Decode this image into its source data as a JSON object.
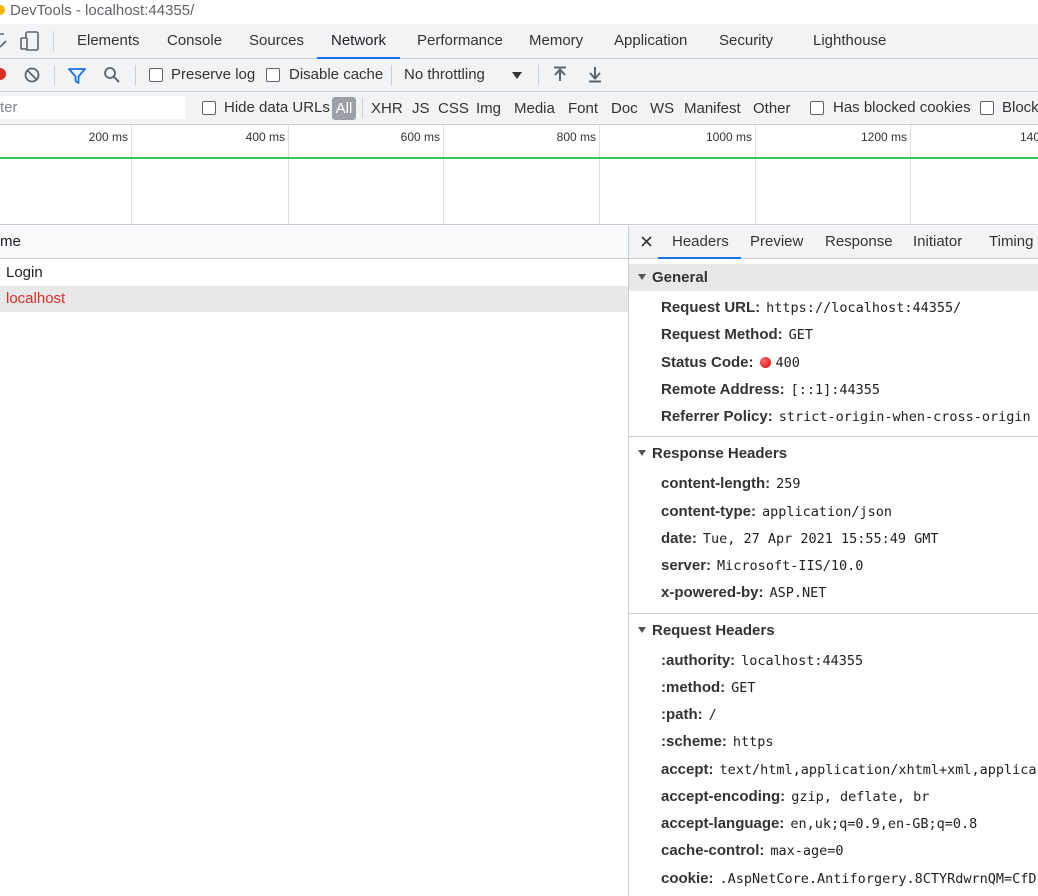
{
  "window": {
    "title": "DevTools - localhost:44355/"
  },
  "main_tabs": [
    "Elements",
    "Console",
    "Sources",
    "Network",
    "Performance",
    "Memory",
    "Application",
    "Security",
    "Lighthouse"
  ],
  "active_tab": "Network",
  "toolbar": {
    "preserve_log": "Preserve log",
    "disable_cache": "Disable cache",
    "throttling": "No throttling"
  },
  "filter": {
    "placeholder": "ter",
    "hide_data_urls": "Hide data URLs",
    "types": [
      "All",
      "XHR",
      "JS",
      "CSS",
      "Img",
      "Media",
      "Font",
      "Doc",
      "WS",
      "Manifest",
      "Other"
    ],
    "has_blocked_cookies": "Has blocked cookies",
    "blocked": "Block"
  },
  "overview": {
    "ticks": [
      "200 ms",
      "400 ms",
      "600 ms",
      "800 ms",
      "1000 ms",
      "1200 ms",
      "140"
    ]
  },
  "request_list": {
    "column_name": "me",
    "rows": [
      {
        "name": "Login",
        "status": "ok"
      },
      {
        "name": "localhost",
        "status": "error"
      }
    ]
  },
  "details": {
    "close_icon": "close-icon",
    "tabs": [
      "Headers",
      "Preview",
      "Response",
      "Initiator",
      "Timing"
    ],
    "active_tab": "Headers",
    "general": {
      "title": "General",
      "request_url_label": "Request URL:",
      "request_url": "https://localhost:44355/",
      "method_label": "Request Method:",
      "method": "GET",
      "status_label": "Status Code:",
      "status": "400",
      "remote_label": "Remote Address:",
      "remote": "[::1]:44355",
      "referrer_label": "Referrer Policy:",
      "referrer": "strict-origin-when-cross-origin"
    },
    "response_headers": {
      "title": "Response Headers",
      "items": [
        {
          "k": "content-length:",
          "v": "259"
        },
        {
          "k": "content-type:",
          "v": "application/json"
        },
        {
          "k": "date:",
          "v": "Tue, 27 Apr 2021 15:55:49 GMT"
        },
        {
          "k": "server:",
          "v": "Microsoft-IIS/10.0"
        },
        {
          "k": "x-powered-by:",
          "v": "ASP.NET"
        }
      ]
    },
    "request_headers": {
      "title": "Request Headers",
      "items": [
        {
          "k": ":authority:",
          "v": "localhost:44355"
        },
        {
          "k": ":method:",
          "v": "GET"
        },
        {
          "k": ":path:",
          "v": "/"
        },
        {
          "k": ":scheme:",
          "v": "https"
        },
        {
          "k": "accept:",
          "v": "text/html,application/xhtml+xml,applica"
        },
        {
          "k": "accept-encoding:",
          "v": "gzip, deflate, br"
        },
        {
          "k": "accept-language:",
          "v": "en,uk;q=0.9,en-GB;q=0.8"
        },
        {
          "k": "cache-control:",
          "v": "max-age=0"
        },
        {
          "k": "cookie:",
          "v": ".AspNetCore.Antiforgery.8CTYRdwrnQM=CfD"
        }
      ]
    }
  },
  "colors": {
    "accent": "#1a73e8",
    "error": "#d93025",
    "selected_row": "#e8e8e8",
    "timeline_green": "#34c759"
  }
}
